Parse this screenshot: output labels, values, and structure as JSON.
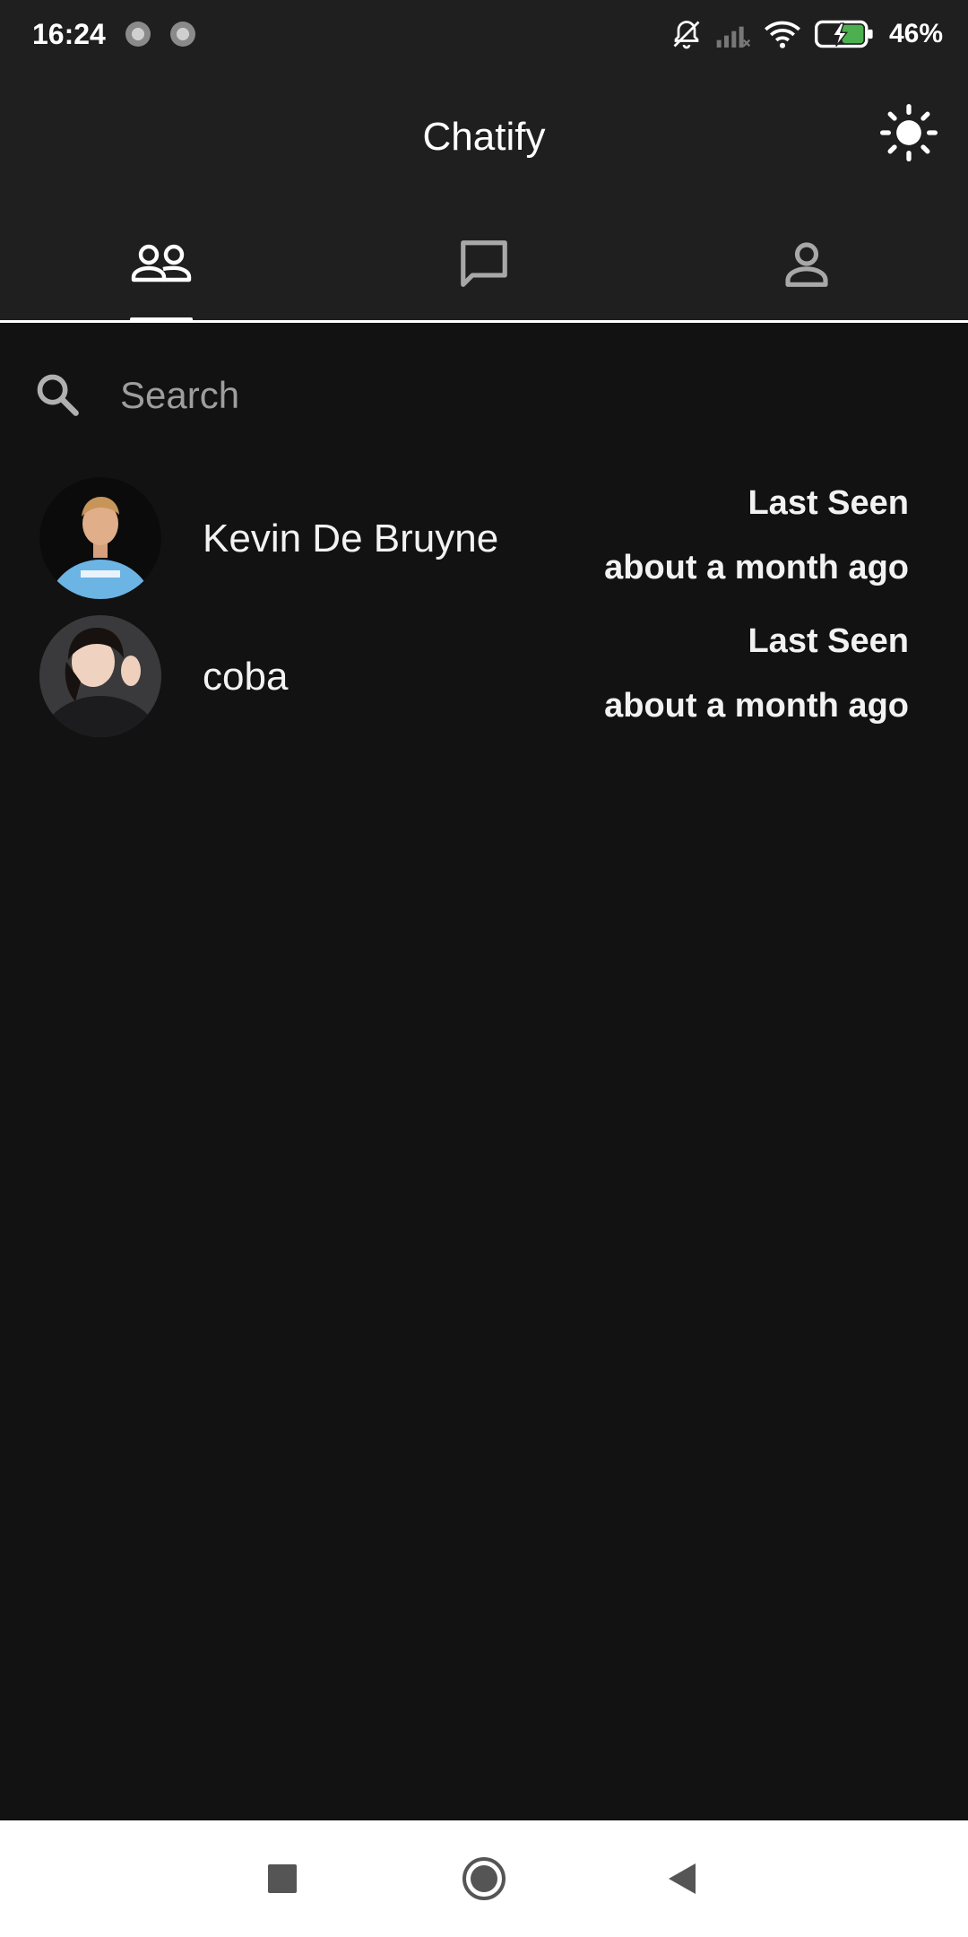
{
  "status_bar": {
    "time": "16:24",
    "battery": "46%",
    "icons": [
      "bell-off-icon",
      "signal-icon",
      "wifi-icon",
      "battery-charging-icon"
    ]
  },
  "app_bar": {
    "title": "Chatify",
    "theme_icon": "sun-icon"
  },
  "tabs": [
    {
      "icon": "friends-icon",
      "selected": true
    },
    {
      "icon": "chat-icon",
      "selected": false
    },
    {
      "icon": "profile-icon",
      "selected": false
    }
  ],
  "search": {
    "placeholder": "Search",
    "value": ""
  },
  "contacts": [
    {
      "name": "Kevin De Bruyne",
      "seen_label": "Last Seen",
      "seen_time": "about a month ago"
    },
    {
      "name": "coba",
      "seen_label": "Last Seen",
      "seen_time": "about a month ago"
    }
  ],
  "colors": {
    "background": "#121212",
    "bar": "#1f1f20",
    "text": "#ffffff",
    "muted": "#9e9e9e",
    "battery_accent": "#4caf50"
  }
}
